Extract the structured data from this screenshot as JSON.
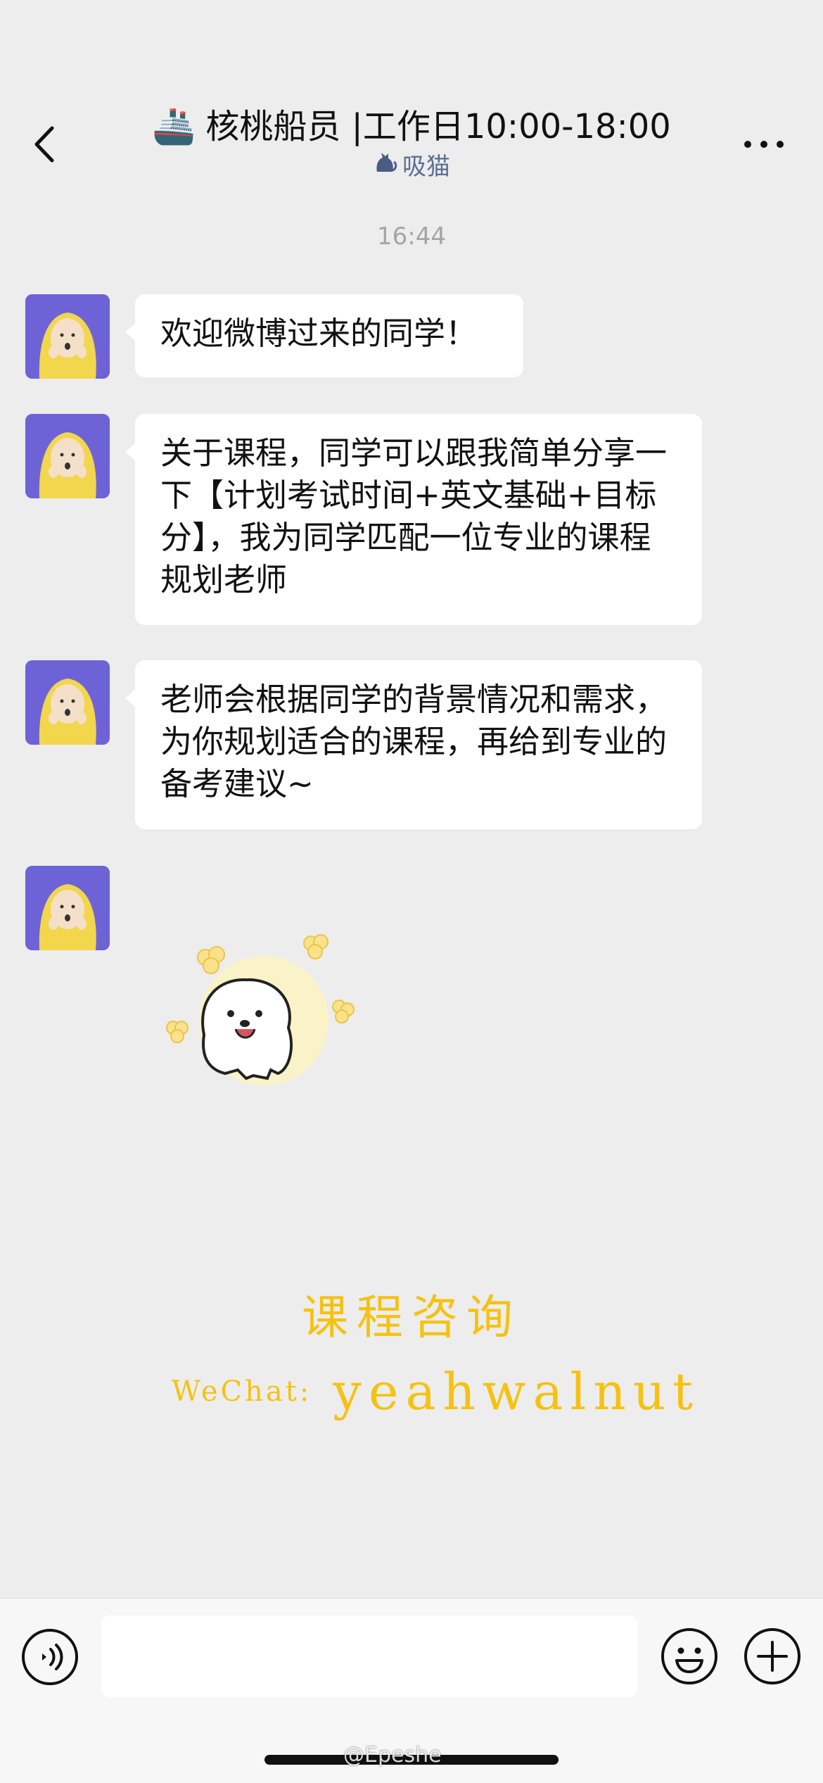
{
  "header": {
    "ship_emoji": "🚢",
    "title": "核桃船员 |工作日10:00-18:00",
    "subtitle": "吸猫",
    "subtitle_icon": "cat-icon",
    "back_icon": "chevron-left-icon",
    "more_icon": "more-dots-icon"
  },
  "chat": {
    "timestamp": "16:44",
    "messages": [
      {
        "type": "text",
        "text": "欢迎微博过来的同学！"
      },
      {
        "type": "text",
        "text": "关于课程，同学可以跟我简单分享一下【计划考试时间+英文基础+目标分】，我为同学匹配一位专业的课程规划老师"
      },
      {
        "type": "text",
        "text": "老师会根据同学的背景情况和需求，为你规划适合的课程，再给到专业的备考建议~"
      },
      {
        "type": "sticker",
        "sticker": "white-puppy-sticker"
      }
    ]
  },
  "promo": {
    "title": "课程咨询",
    "wechat_label": "WeChat:",
    "wechat_id": "yeahwalnut",
    "color": "#f5c213"
  },
  "input_bar": {
    "voice_icon": "voice-icon",
    "emoji_icon": "emoji-icon",
    "plus_icon": "plus-icon",
    "input_value": ""
  },
  "watermark": "@Epeshe",
  "colors": {
    "background": "#ededed",
    "bubble": "#ffffff",
    "avatar_bg": "#6e63d6",
    "subtitle": "#5c6e94"
  }
}
